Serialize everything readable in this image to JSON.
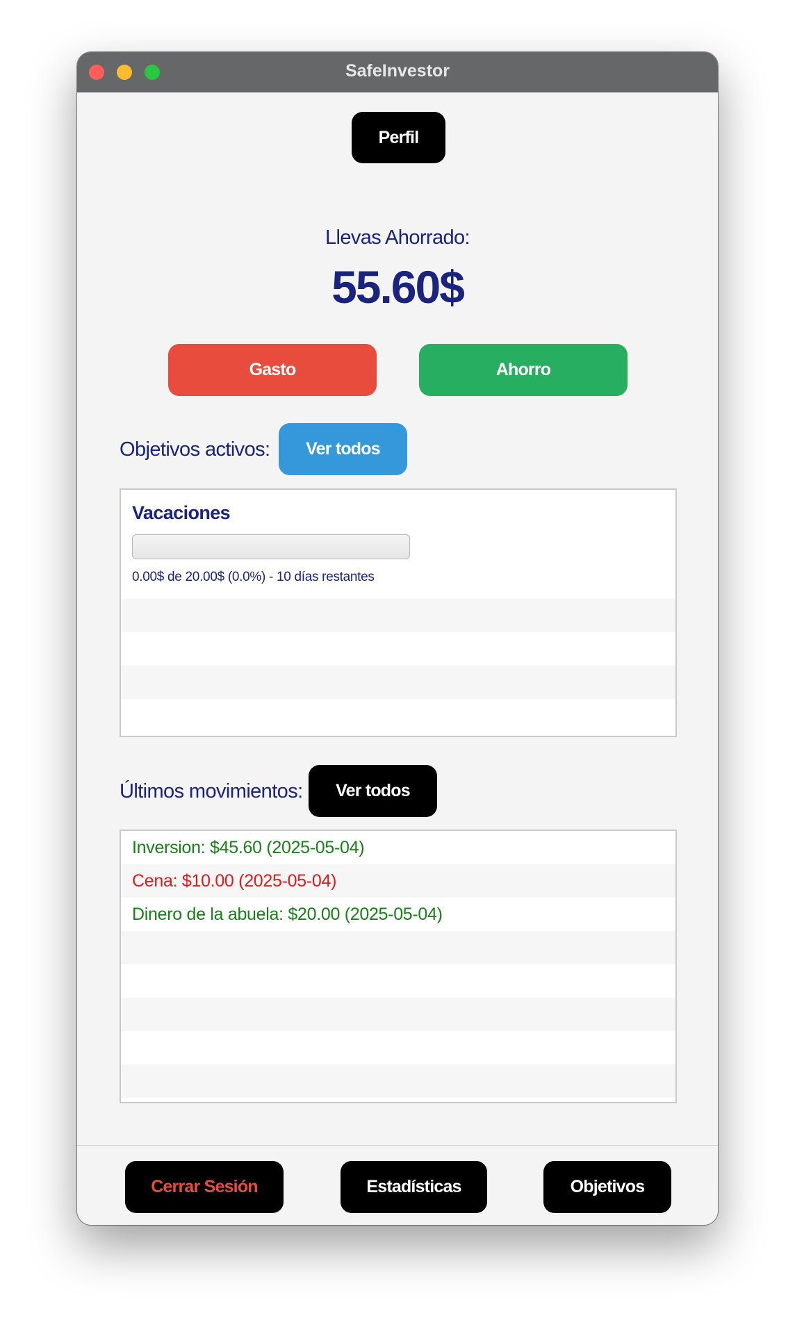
{
  "window": {
    "title": "SafeInvestor"
  },
  "header": {
    "profile_label": "Perfil"
  },
  "summary": {
    "saved_label": "Llevas Ahorrado:",
    "saved_amount": "55.60$"
  },
  "actions": {
    "expense_label": "Gasto",
    "saving_label": "Ahorro"
  },
  "goals": {
    "heading": "Objetivos activos:",
    "view_all_label": "Ver todos",
    "items": [
      {
        "name": "Vacaciones",
        "progress": 0.0,
        "info": "0.00$ de 20.00$ (0.0%) - 10 días restantes"
      }
    ]
  },
  "movements": {
    "heading": "Últimos movimientos:",
    "view_all_label": "Ver todos",
    "items": [
      {
        "text": "Inversion: $45.60 (2025-05-04)",
        "type": "income"
      },
      {
        "text": "Cena: $10.00 (2025-05-04)",
        "type": "expense"
      },
      {
        "text": "Dinero de la abuela: $20.00 (2025-05-04)",
        "type": "income"
      }
    ]
  },
  "footer": {
    "logout_label": "Cerrar Sesión",
    "stats_label": "Estadísticas",
    "goals_label": "Objetivos"
  },
  "colors": {
    "expense": "#e74c3c",
    "saving": "#27ae60",
    "view_all_goals": "#3498db",
    "text_primary": "#1a237e",
    "income_text": "#178017",
    "expense_text": "#e01a1a"
  }
}
